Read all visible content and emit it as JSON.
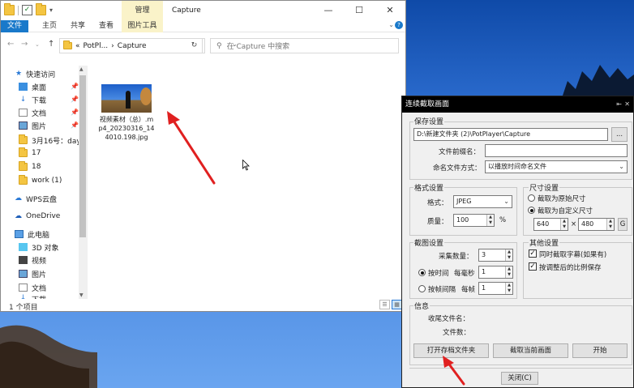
{
  "explorer": {
    "manage_tab": "管理",
    "title": "Capture",
    "controls": {
      "minimize": "—",
      "maximize": "☐",
      "close": "✕"
    },
    "ribbon_tabs": {
      "file": "文件",
      "home": "主页",
      "share": "共享",
      "view": "查看",
      "picture_tools": "图片工具"
    },
    "address": {
      "prefix": "«",
      "segment1": "PotPl...",
      "separator": "›",
      "segment2": "Capture"
    },
    "search_placeholder": "在 Capture 中搜索",
    "sidebar": {
      "quick_access": "快速访问",
      "desktop": "桌面",
      "downloads": "下载",
      "documents": "文档",
      "pictures": "图片",
      "folder_march16": "3月16号：day1",
      "folder_17": "17",
      "folder_18": "18",
      "folder_work": "work (1)",
      "wps_cloud": "WPS云盘",
      "onedrive": "OneDrive",
      "this_pc": "此电脑",
      "objects_3d": "3D 对象",
      "videos": "视频",
      "pc_pictures": "图片",
      "pc_documents": "文档",
      "pc_downloads": "下载"
    },
    "file": {
      "name": "视频素材（总）.mp4_20230316_144010.198.jpg"
    },
    "status": "1 个项目"
  },
  "dialog": {
    "title": "连续截取画面",
    "save_group": "保存设置",
    "save_path": "D:\\新建文件夹 (2)\\PotPlayer\\Capture",
    "browse": "...",
    "prefix_label": "文件前缀名：",
    "prefix_value": "",
    "naming_label": "命名文件方式：",
    "naming_value": "以播放时间命名文件",
    "format_group": "格式设置",
    "format_label": "格式：",
    "format_value": "JPEG",
    "quality_label": "质量：",
    "quality_value": "100",
    "quality_unit": "%",
    "size_group": "尺寸设置",
    "size_original": "截取为原始尺寸",
    "size_custom": "截取为自定义尺寸",
    "width": "640",
    "times": "×",
    "height": "480",
    "size_extra": "G",
    "capture_group": "截图设置",
    "count_label": "采集数量：",
    "count_value": "3",
    "by_time": "按时间",
    "per_second_label": "每毫秒",
    "per_second_value": "1",
    "by_frame": "按帧间隔",
    "per_frame_label": "每帧",
    "per_frame_value": "1",
    "other_group": "其他设置",
    "opt_subtitles": "同时截取字幕(如果有)",
    "opt_aspect": "按调整后的比例保存",
    "info_group": "信息",
    "last_file_label": "收尾文件名：",
    "file_count_label": "文件数：",
    "btn_open_folder": "打开存档文件夹",
    "btn_capture_current": "截取当前画面",
    "btn_start": "开始",
    "btn_close": "关闭(C)"
  }
}
